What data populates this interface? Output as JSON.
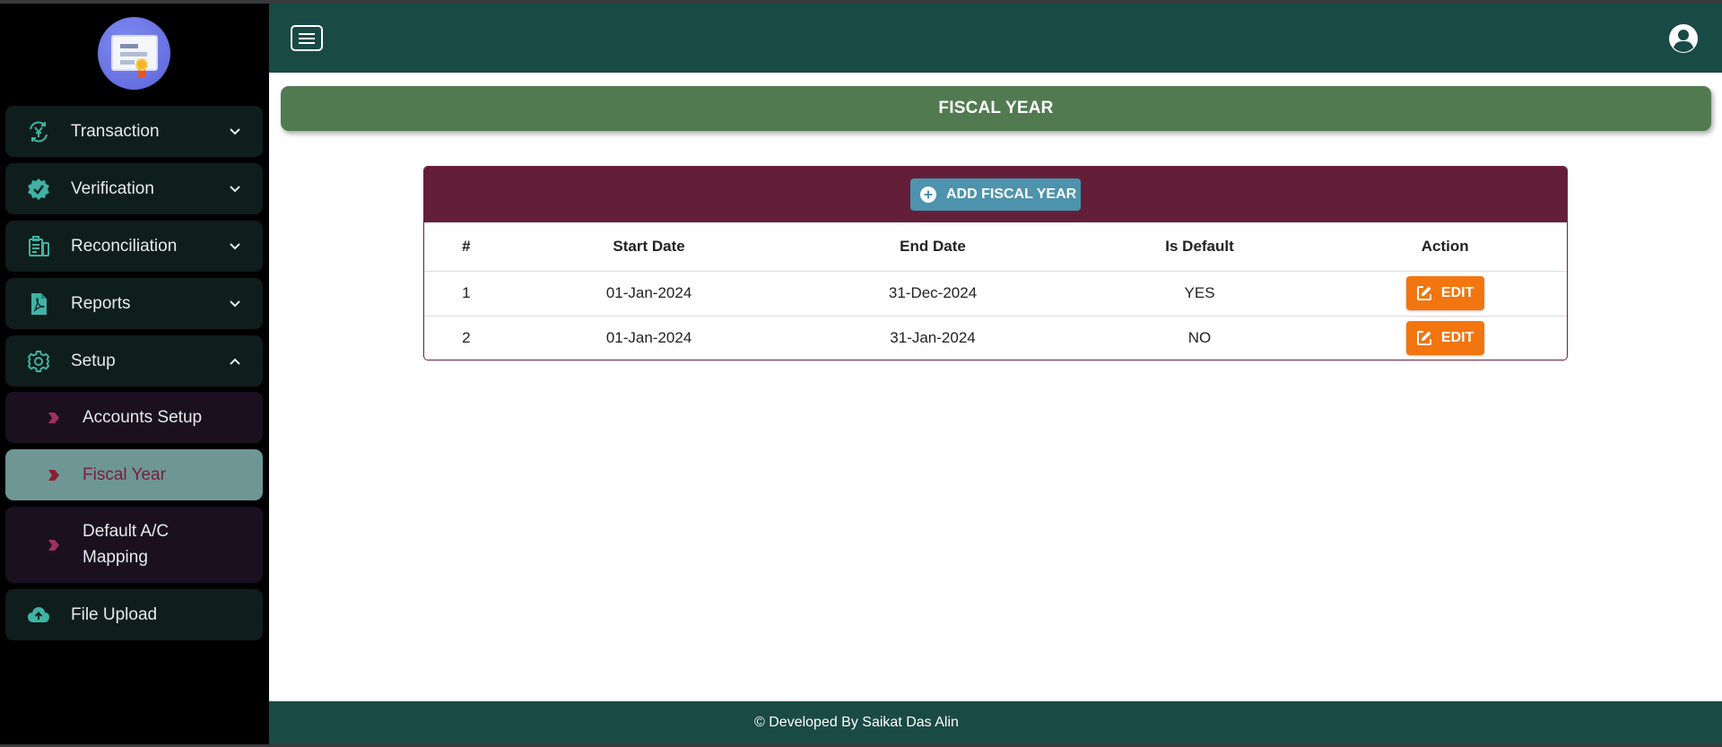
{
  "sidebar": {
    "items": [
      {
        "label": "Transaction",
        "icon": "yen-cycle-icon"
      },
      {
        "label": "Verification",
        "icon": "verified-badge-icon"
      },
      {
        "label": "Reconciliation",
        "icon": "reconciliation-icon"
      },
      {
        "label": "Reports",
        "icon": "pdf-file-icon"
      },
      {
        "label": "Setup",
        "icon": "gear-icon"
      }
    ],
    "setup_sub_items": [
      {
        "label": "Accounts Setup"
      },
      {
        "label": "Fiscal Year"
      },
      {
        "label": "Default A/C Mapping"
      }
    ],
    "file_upload": {
      "label": "File Upload",
      "icon": "cloud-upload-icon"
    }
  },
  "page": {
    "title": "FISCAL YEAR",
    "add_button_label": "ADD FISCAL YEAR"
  },
  "table": {
    "columns": [
      "#",
      "Start Date",
      "End Date",
      "Is Default",
      "Action"
    ],
    "rows": [
      {
        "num": "1",
        "start": "01-Jan-2024",
        "end": "31-Dec-2024",
        "is_default": "YES",
        "action": "EDIT"
      },
      {
        "num": "2",
        "start": "01-Jan-2024",
        "end": "31-Jan-2024",
        "is_default": "NO",
        "action": "EDIT"
      }
    ]
  },
  "footer": {
    "text": "© Developed By Saikat Das Alin"
  },
  "colors": {
    "sidebar_bg": "#000000",
    "nav_item_bg": "#0f1e1b",
    "icon_teal": "#3fb3a6",
    "header_bg": "#1a4a45",
    "title_bar_bg": "#527a50",
    "card_head_bg": "#631f38",
    "add_button_bg": "#4d93ad",
    "edit_button_bg": "#f2750f",
    "active_sub_bg": "#6d9694",
    "active_sub_text": "#7a1e3a"
  }
}
